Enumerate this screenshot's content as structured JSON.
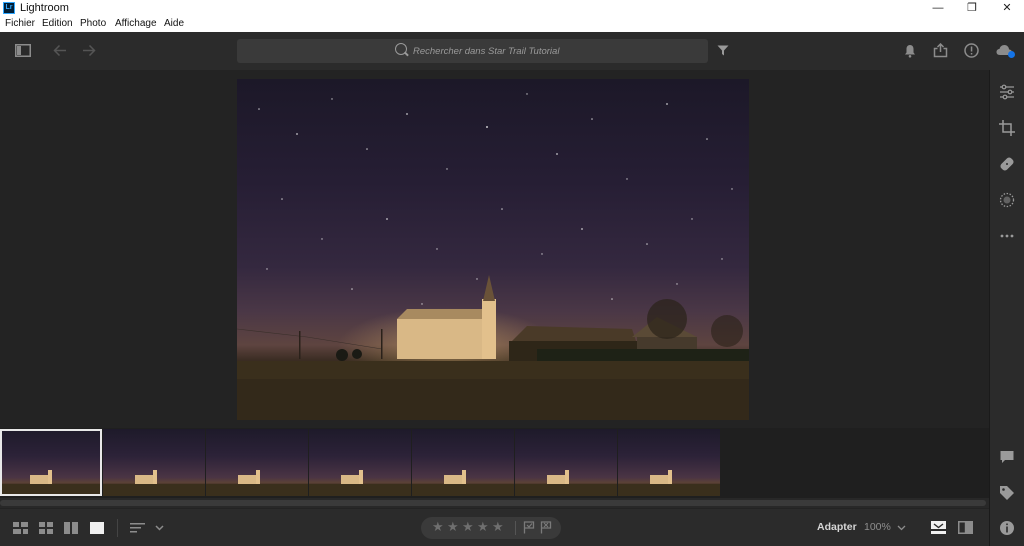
{
  "window": {
    "title": "Lightroom",
    "logo_text": "Lr",
    "minimize": "—",
    "restore": "❐",
    "close": "✕"
  },
  "menu": {
    "items": [
      "Fichier",
      "Edition",
      "Photo",
      "Affichage",
      "Aide"
    ]
  },
  "toolbar": {
    "search_placeholder": "Rechercher dans Star Trail Tutorial"
  },
  "bottombar": {
    "fit_label": "Adapter",
    "zoom_level": "100%",
    "stars": [
      "★",
      "★",
      "★",
      "★",
      "★"
    ]
  },
  "filmstrip": {
    "thumbnail_count": 7,
    "selected_index": 0
  },
  "colors": {
    "background": "#1f1f1f",
    "panel": "#2b2b2b",
    "accent_cloud": "#1473e6"
  }
}
